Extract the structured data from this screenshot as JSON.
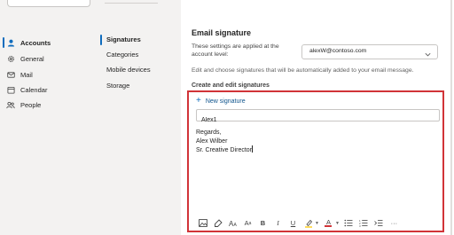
{
  "nav": {
    "items": [
      {
        "label": "Accounts",
        "icon": "person-icon"
      },
      {
        "label": "General",
        "icon": "gear-icon"
      },
      {
        "label": "Mail",
        "icon": "mail-icon"
      },
      {
        "label": "Calendar",
        "icon": "calendar-icon"
      },
      {
        "label": "People",
        "icon": "people-icon"
      }
    ],
    "active_index": 0
  },
  "subnav": {
    "items": [
      {
        "label": "Signatures"
      },
      {
        "label": "Categories"
      },
      {
        "label": "Mobile devices"
      },
      {
        "label": "Storage"
      }
    ],
    "active_index": 0
  },
  "signature": {
    "title": "Email signature",
    "account_label": "These settings are applied at the account level:",
    "account_value": "alexW@contoso.com",
    "description": "Edit and choose signatures that will be automatically added to your email message.",
    "section_title": "Create and edit signatures",
    "new_label": "New signature",
    "name_value": "Alex1",
    "body_lines": [
      "Regards,",
      "Alex Wilber",
      "Sr. Creative Director"
    ]
  },
  "toolbar": {
    "bold": "B",
    "italic": "I",
    "underline": "U",
    "font_color": "A",
    "font_size": "A",
    "more": "···"
  },
  "colors": {
    "accent": "#0f6cbd",
    "highlight_border": "#d13438",
    "highlight_yellow": "#ffd335",
    "font_red": "#d13438"
  }
}
